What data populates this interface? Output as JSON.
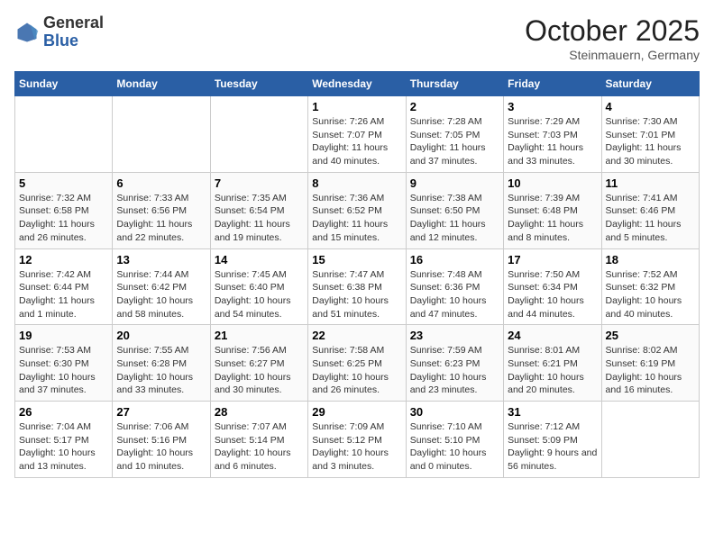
{
  "header": {
    "logo_general": "General",
    "logo_blue": "Blue",
    "month": "October 2025",
    "location": "Steinmauern, Germany"
  },
  "weekdays": [
    "Sunday",
    "Monday",
    "Tuesday",
    "Wednesday",
    "Thursday",
    "Friday",
    "Saturday"
  ],
  "weeks": [
    [
      {
        "day": "",
        "info": ""
      },
      {
        "day": "",
        "info": ""
      },
      {
        "day": "",
        "info": ""
      },
      {
        "day": "1",
        "info": "Sunrise: 7:26 AM\nSunset: 7:07 PM\nDaylight: 11 hours and 40 minutes."
      },
      {
        "day": "2",
        "info": "Sunrise: 7:28 AM\nSunset: 7:05 PM\nDaylight: 11 hours and 37 minutes."
      },
      {
        "day": "3",
        "info": "Sunrise: 7:29 AM\nSunset: 7:03 PM\nDaylight: 11 hours and 33 minutes."
      },
      {
        "day": "4",
        "info": "Sunrise: 7:30 AM\nSunset: 7:01 PM\nDaylight: 11 hours and 30 minutes."
      }
    ],
    [
      {
        "day": "5",
        "info": "Sunrise: 7:32 AM\nSunset: 6:58 PM\nDaylight: 11 hours and 26 minutes."
      },
      {
        "day": "6",
        "info": "Sunrise: 7:33 AM\nSunset: 6:56 PM\nDaylight: 11 hours and 22 minutes."
      },
      {
        "day": "7",
        "info": "Sunrise: 7:35 AM\nSunset: 6:54 PM\nDaylight: 11 hours and 19 minutes."
      },
      {
        "day": "8",
        "info": "Sunrise: 7:36 AM\nSunset: 6:52 PM\nDaylight: 11 hours and 15 minutes."
      },
      {
        "day": "9",
        "info": "Sunrise: 7:38 AM\nSunset: 6:50 PM\nDaylight: 11 hours and 12 minutes."
      },
      {
        "day": "10",
        "info": "Sunrise: 7:39 AM\nSunset: 6:48 PM\nDaylight: 11 hours and 8 minutes."
      },
      {
        "day": "11",
        "info": "Sunrise: 7:41 AM\nSunset: 6:46 PM\nDaylight: 11 hours and 5 minutes."
      }
    ],
    [
      {
        "day": "12",
        "info": "Sunrise: 7:42 AM\nSunset: 6:44 PM\nDaylight: 11 hours and 1 minute."
      },
      {
        "day": "13",
        "info": "Sunrise: 7:44 AM\nSunset: 6:42 PM\nDaylight: 10 hours and 58 minutes."
      },
      {
        "day": "14",
        "info": "Sunrise: 7:45 AM\nSunset: 6:40 PM\nDaylight: 10 hours and 54 minutes."
      },
      {
        "day": "15",
        "info": "Sunrise: 7:47 AM\nSunset: 6:38 PM\nDaylight: 10 hours and 51 minutes."
      },
      {
        "day": "16",
        "info": "Sunrise: 7:48 AM\nSunset: 6:36 PM\nDaylight: 10 hours and 47 minutes."
      },
      {
        "day": "17",
        "info": "Sunrise: 7:50 AM\nSunset: 6:34 PM\nDaylight: 10 hours and 44 minutes."
      },
      {
        "day": "18",
        "info": "Sunrise: 7:52 AM\nSunset: 6:32 PM\nDaylight: 10 hours and 40 minutes."
      }
    ],
    [
      {
        "day": "19",
        "info": "Sunrise: 7:53 AM\nSunset: 6:30 PM\nDaylight: 10 hours and 37 minutes."
      },
      {
        "day": "20",
        "info": "Sunrise: 7:55 AM\nSunset: 6:28 PM\nDaylight: 10 hours and 33 minutes."
      },
      {
        "day": "21",
        "info": "Sunrise: 7:56 AM\nSunset: 6:27 PM\nDaylight: 10 hours and 30 minutes."
      },
      {
        "day": "22",
        "info": "Sunrise: 7:58 AM\nSunset: 6:25 PM\nDaylight: 10 hours and 26 minutes."
      },
      {
        "day": "23",
        "info": "Sunrise: 7:59 AM\nSunset: 6:23 PM\nDaylight: 10 hours and 23 minutes."
      },
      {
        "day": "24",
        "info": "Sunrise: 8:01 AM\nSunset: 6:21 PM\nDaylight: 10 hours and 20 minutes."
      },
      {
        "day": "25",
        "info": "Sunrise: 8:02 AM\nSunset: 6:19 PM\nDaylight: 10 hours and 16 minutes."
      }
    ],
    [
      {
        "day": "26",
        "info": "Sunrise: 7:04 AM\nSunset: 5:17 PM\nDaylight: 10 hours and 13 minutes."
      },
      {
        "day": "27",
        "info": "Sunrise: 7:06 AM\nSunset: 5:16 PM\nDaylight: 10 hours and 10 minutes."
      },
      {
        "day": "28",
        "info": "Sunrise: 7:07 AM\nSunset: 5:14 PM\nDaylight: 10 hours and 6 minutes."
      },
      {
        "day": "29",
        "info": "Sunrise: 7:09 AM\nSunset: 5:12 PM\nDaylight: 10 hours and 3 minutes."
      },
      {
        "day": "30",
        "info": "Sunrise: 7:10 AM\nSunset: 5:10 PM\nDaylight: 10 hours and 0 minutes."
      },
      {
        "day": "31",
        "info": "Sunrise: 7:12 AM\nSunset: 5:09 PM\nDaylight: 9 hours and 56 minutes."
      },
      {
        "day": "",
        "info": ""
      }
    ]
  ]
}
